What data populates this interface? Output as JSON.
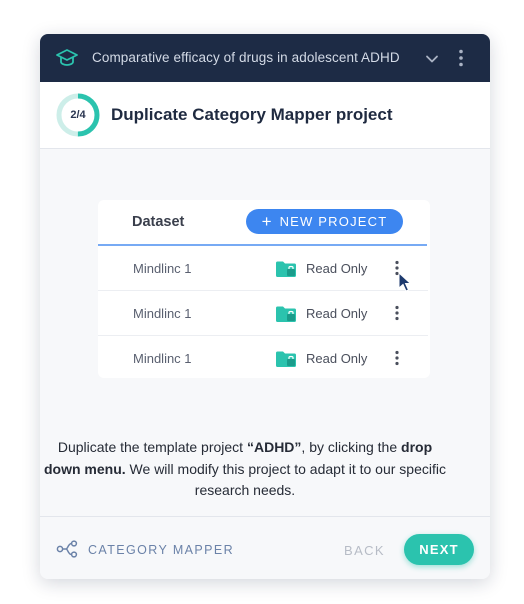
{
  "header": {
    "title": "Comparative efficacy of drugs in adolescent ADHD",
    "left_icon": "graduation-cap-icon",
    "expand_icon": "chevron-down-icon",
    "menu_icon": "vertical-dots-icon"
  },
  "step": {
    "progress_label": "2/4",
    "progress_fraction": 0.5,
    "title": "Duplicate Category Mapper project"
  },
  "illustration": {
    "column_header": "Dataset",
    "new_project_plus": "+",
    "new_project_label": "NEW PROJECT",
    "rows": [
      {
        "name": "Mindlinc 1",
        "access": "Read Only"
      },
      {
        "name": "Mindlinc 1",
        "access": "Read Only"
      },
      {
        "name": "Mindlinc 1",
        "access": "Read Only"
      }
    ]
  },
  "description": {
    "p1": "Duplicate the template project ",
    "bold1": "“ADHD”",
    "p2": ", by clicking the ",
    "bold2": "drop down menu.",
    "p3": " We will modify this project to adapt it to our specific research needs."
  },
  "footer": {
    "module_icon": "category-mapper-icon",
    "module_label": "CATEGORY MAPPER",
    "back_label": "BACK",
    "next_label": "NEXT"
  },
  "colors": {
    "header_bg": "#1d2b45",
    "accent_teal": "#2bc3ae",
    "accent_blue": "#3d86f0",
    "muted_label": "#6b82a8"
  }
}
